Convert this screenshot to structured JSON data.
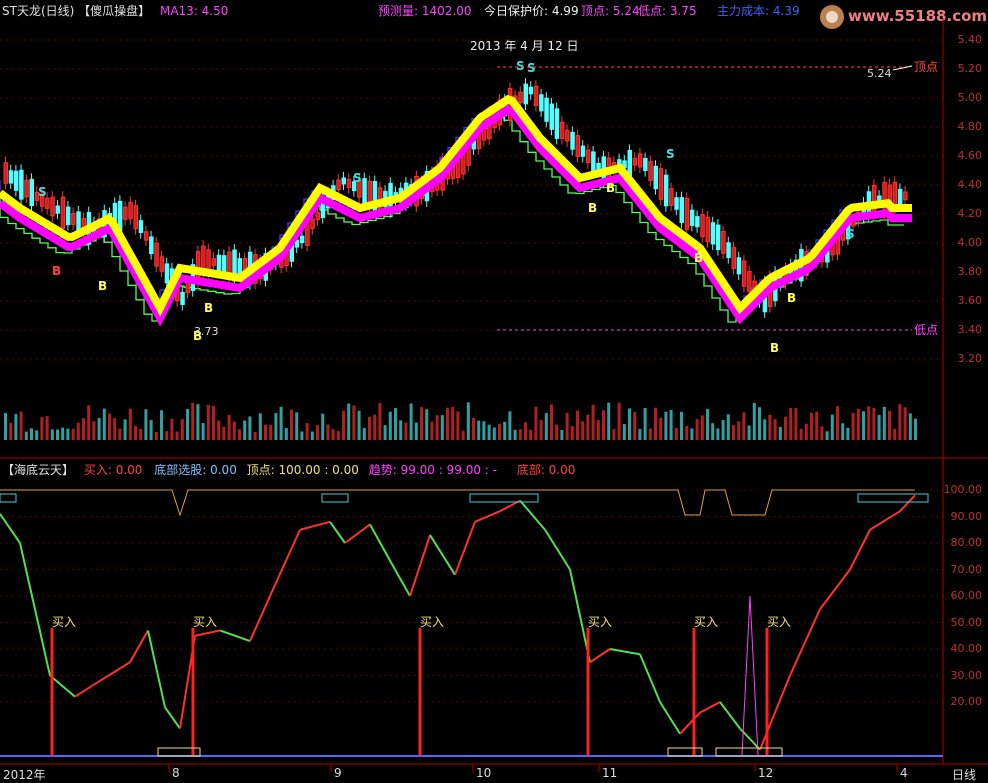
{
  "header": {
    "stock_name": "ST天龙(日线)",
    "formula_name": "【傻瓜操盘】",
    "ma_label": "MA13: 4.50",
    "forecast_label": "预测量: 1402.00",
    "protect_label": "今日保护价: 4.99",
    "top_label": "顶点: 5.24",
    "low_label": "低点: 3.75",
    "cost_label": "主力成本: 4.39"
  },
  "watermark": "www.55188.com",
  "price_panel": {
    "date_marker": "2013 年 4 月 12 日",
    "top_value": "5.24",
    "top_tag": "顶点",
    "low_tag": "低点",
    "low_value": "3.73",
    "y_ticks": [
      "5.40",
      "5.20",
      "5.00",
      "4.80",
      "4.60",
      "4.40",
      "4.20",
      "4.00",
      "3.80",
      "3.60",
      "3.40",
      "3.20"
    ]
  },
  "indicator_panel": {
    "title": "【海底云天】",
    "buy_label": "买入: 0.00",
    "bottom_select_label": "底部选股: 0.00",
    "top_point_label": "顶点: 100.00 : 0.00",
    "trend_label": "趋势: 99.00 : 99.00 : -",
    "bottom_label": "底部: 0.00",
    "buy_marker": "买入",
    "y_ticks": [
      "100.00",
      "90.00",
      "80.00",
      "70.00",
      "60.00",
      "50.00",
      "40.00",
      "30.00",
      "20.00"
    ]
  },
  "x_axis": {
    "labels": [
      "2012年",
      "8",
      "9",
      "10",
      "11",
      "12",
      "4"
    ],
    "period": "日线"
  },
  "signals": {
    "buy": "B",
    "sell": "S"
  },
  "colors": {
    "rise": "#ff3232",
    "fall": "#54ffff",
    "ma_yellow": "#ffff00",
    "ma_magenta": "#ff00ff",
    "ladder_blue": "#3c3cff",
    "ladder_green": "#54ff54",
    "grid_red": "#8b0000"
  }
}
